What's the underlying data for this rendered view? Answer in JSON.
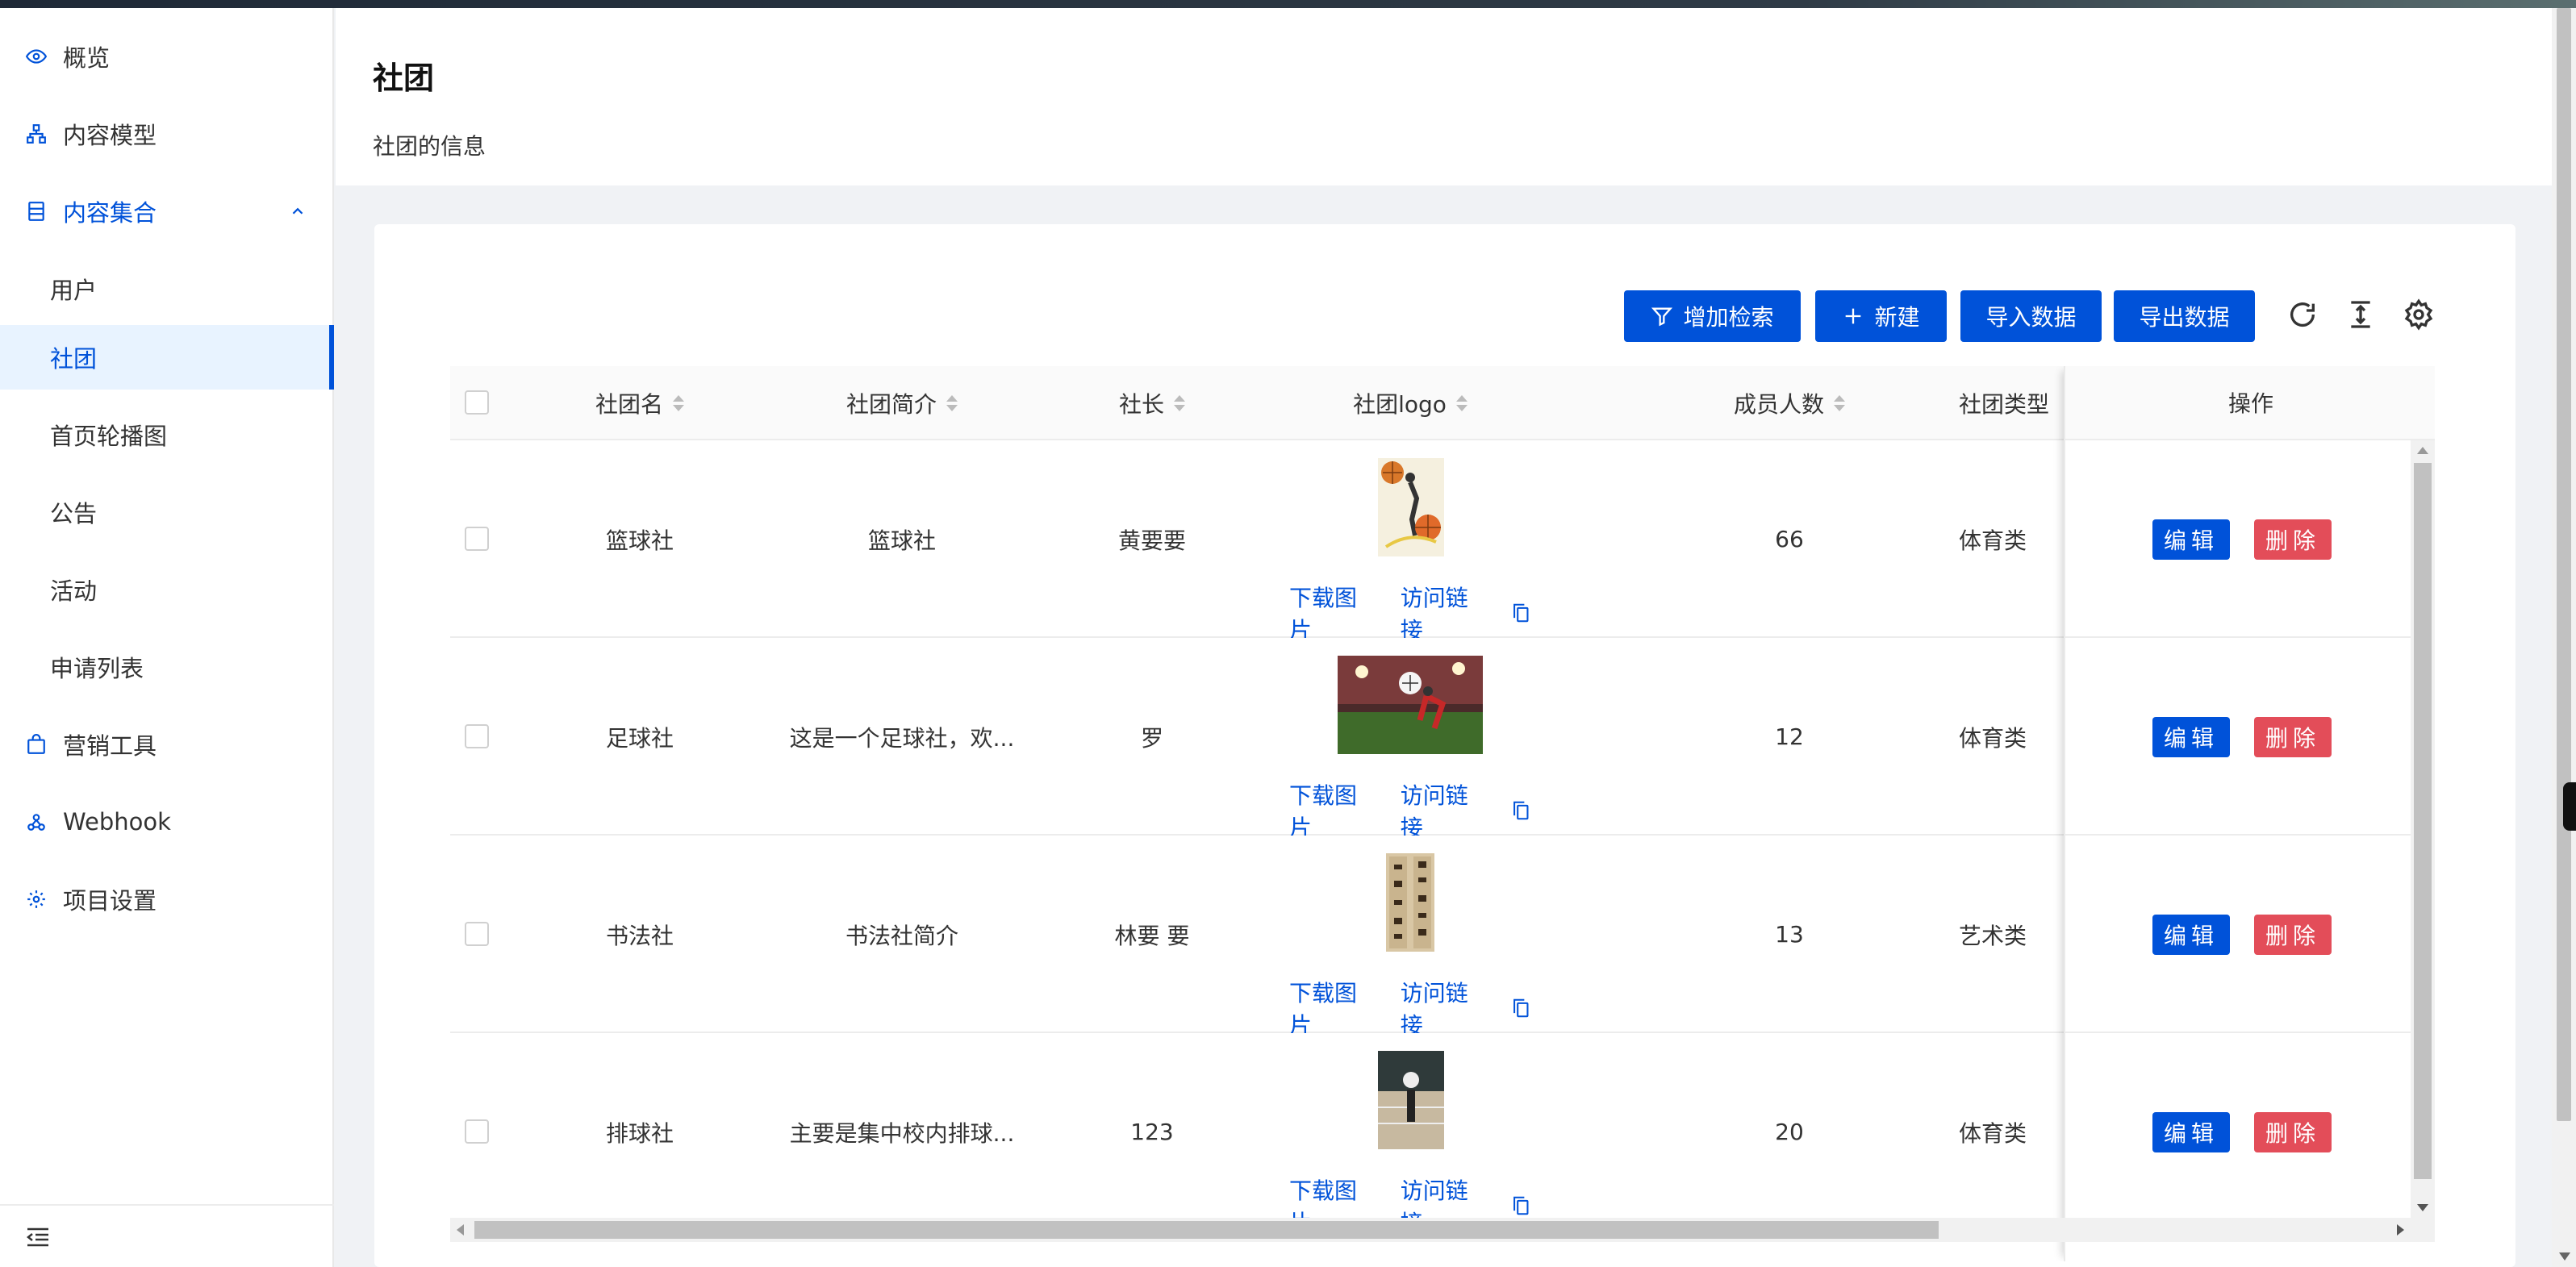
{
  "sidebar": {
    "items": [
      {
        "label": "概览",
        "icon": "eye-icon"
      },
      {
        "label": "内容模型",
        "icon": "model-icon"
      },
      {
        "label": "内容集合",
        "icon": "collection-icon"
      },
      {
        "label": "用户"
      },
      {
        "label": "社团"
      },
      {
        "label": "首页轮播图"
      },
      {
        "label": "公告"
      },
      {
        "label": "活动"
      },
      {
        "label": "申请列表"
      },
      {
        "label": "营销工具",
        "icon": "bag-icon"
      },
      {
        "label": "Webhook",
        "icon": "webhook-icon"
      },
      {
        "label": "项目设置",
        "icon": "gear-icon"
      }
    ]
  },
  "header": {
    "title": "社团",
    "description": "社团的信息"
  },
  "toolbar": {
    "filter_label": "增加检索",
    "new_label": "新建",
    "import_label": "导入数据",
    "export_label": "导出数据"
  },
  "colors": {
    "accent": "#0052d9",
    "danger": "#e34d59",
    "active_bg": "#e8f3ff"
  },
  "table": {
    "columns": [
      "社团名",
      "社团简介",
      "社长",
      "社团logo",
      "成员人数",
      "社团类型",
      "操作"
    ],
    "rows": [
      {
        "name": "篮球社",
        "intro": "篮球社",
        "leader": "黄要要",
        "members": "66",
        "type": "体育类"
      },
      {
        "name": "足球社",
        "intro": "这是一个足球社，欢...",
        "leader": "罗",
        "members": "12",
        "type": "体育类"
      },
      {
        "name": "书法社",
        "intro": "书法社简介",
        "leader": "林要 要",
        "members": "13",
        "type": "艺术类"
      },
      {
        "name": "排球社",
        "intro": "主要是集中校内排球...",
        "leader": "123",
        "members": "20",
        "type": "体育类"
      }
    ],
    "logo_download": "下载图片",
    "logo_visit": "访问链接",
    "edit_label": "编辑",
    "delete_label": "删除"
  }
}
